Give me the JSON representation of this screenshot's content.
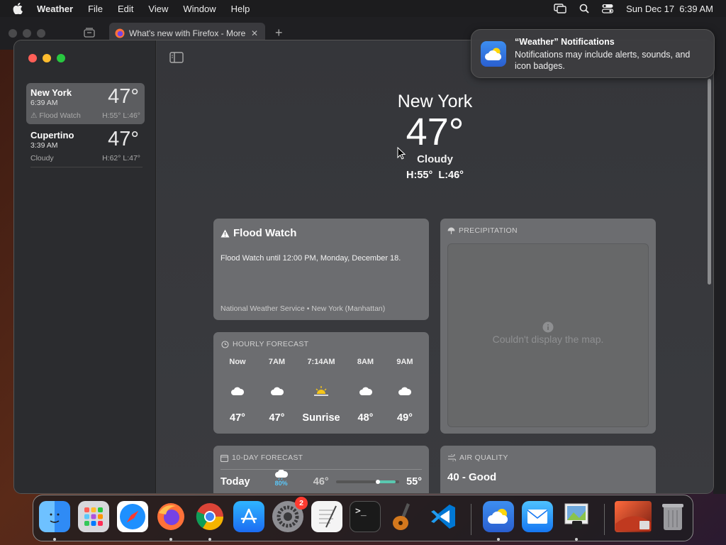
{
  "menubar": {
    "app_name": "Weather",
    "menus": [
      "File",
      "Edit",
      "View",
      "Window",
      "Help"
    ],
    "datetime": "Sun Dec 17  6:39 AM"
  },
  "firefox": {
    "tab_title": "What's new with Firefox - More"
  },
  "sidebar": {
    "locations": [
      {
        "name": "New York",
        "time": "6:39 AM",
        "temp": "47°",
        "condition": "⚠ Flood Watch",
        "hl": "H:55°  L:46°",
        "selected": true
      },
      {
        "name": "Cupertino",
        "time": "3:39 AM",
        "temp": "47°",
        "condition": "Cloudy",
        "hl": "H:62°  L:47°",
        "selected": false
      }
    ]
  },
  "hero": {
    "city": "New York",
    "temp": "47°",
    "condition": "Cloudy",
    "hl": "H:55°  L:46°"
  },
  "flood_card": {
    "title": "Flood Watch",
    "body": "Flood Watch until 12:00 PM, Monday, December 18.",
    "source": "National Weather Service • New York (Manhattan)"
  },
  "hourly_card": {
    "title": "HOURLY FORECAST",
    "hours": [
      {
        "time": "Now",
        "icon": "cloud-icon",
        "value": "47°"
      },
      {
        "time": "7AM",
        "icon": "cloud-icon",
        "value": "47°"
      },
      {
        "time": "7:14AM",
        "icon": "sunrise-icon",
        "value": "Sunrise"
      },
      {
        "time": "8AM",
        "icon": "cloud-icon",
        "value": "48°"
      },
      {
        "time": "9AM",
        "icon": "cloud-icon",
        "value": "49°"
      }
    ]
  },
  "precip_card": {
    "title": "PRECIPITATION",
    "message": "Couldn't display the map."
  },
  "tenday_card": {
    "title": "10-DAY FORECAST",
    "rows": [
      {
        "day": "Today",
        "chance": "80%",
        "low": "46°",
        "high": "55°"
      }
    ]
  },
  "air_card": {
    "title": "AIR QUALITY",
    "value": "40 - Good"
  },
  "notification": {
    "title": "“Weather” Notifications",
    "body": "Notifications may include alerts, sounds, and icon badges."
  },
  "dock": {
    "apps": [
      "Finder",
      "Launchpad",
      "Safari",
      "Firefox",
      "Chrome",
      "App Store",
      "System Settings",
      "TextEdit",
      "Terminal",
      "GarageBand",
      "VS Code",
      "Weather",
      "Mail",
      "Preview",
      "Wallpaper",
      "Trash"
    ],
    "settings_badge": "2"
  },
  "colors": {
    "accent_teal": "#5ac8b0",
    "badge_red": "#ff3b30"
  }
}
